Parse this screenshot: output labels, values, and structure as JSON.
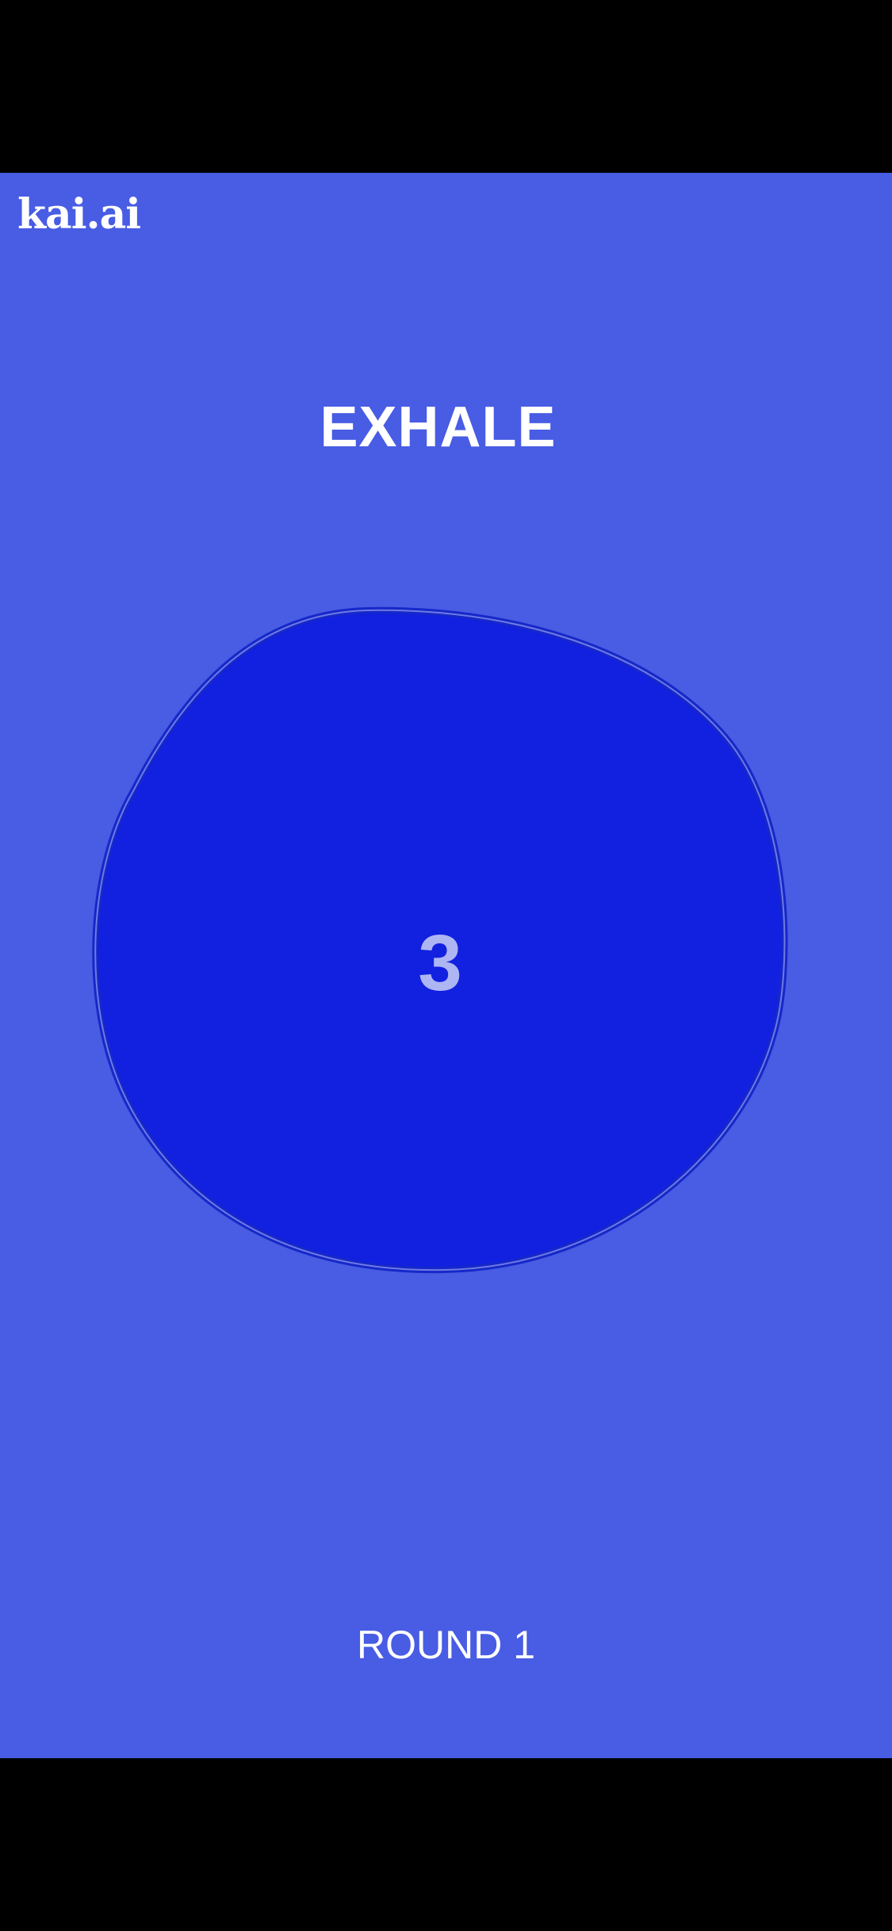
{
  "app": {
    "logo": "kai.ai",
    "phase": "EXHALE",
    "counter": "3",
    "round": "ROUND 1"
  },
  "colors": {
    "background": "#485CE4",
    "blob_fill": "#1220E0",
    "blob_outline": "#8C96F0",
    "counter_text": "#AEB5F3",
    "text": "#FFFFFF",
    "system_bars": "#000000"
  }
}
